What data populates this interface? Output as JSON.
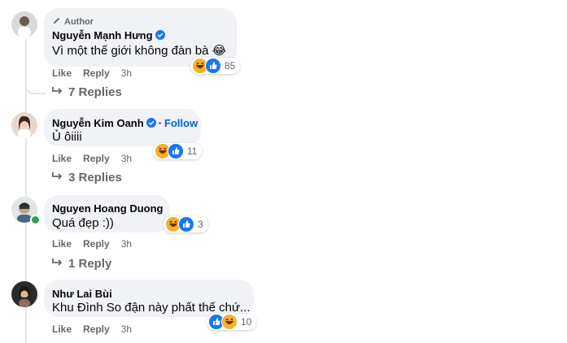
{
  "comments": [
    {
      "author_badge": "Author",
      "name": "Nguyễn Mạnh Hưng",
      "verified": true,
      "text": "Vì một thế giới không đàn bà",
      "emoji": "😂",
      "reaction_count": "85",
      "reactions": [
        "haha",
        "like"
      ],
      "actions": {
        "like": "Like",
        "reply": "Reply",
        "time": "3h"
      },
      "replies": "7 Replies"
    },
    {
      "name": "Nguyễn Kim Oanh",
      "verified": true,
      "follow": "Follow",
      "text": "Ủ ôiiii",
      "reaction_count": "11",
      "reactions": [
        "haha",
        "like"
      ],
      "actions": {
        "like": "Like",
        "reply": "Reply",
        "time": "3h"
      },
      "replies": "3 Replies"
    },
    {
      "name": "Nguyen Hoang Duong",
      "online": true,
      "text": "Quá đẹp :))",
      "reaction_count": "3",
      "reactions": [
        "haha",
        "like"
      ],
      "actions": {
        "like": "Like",
        "reply": "Reply",
        "time": "3h"
      },
      "replies": "1 Reply"
    },
    {
      "name": "Như Lai Bùi",
      "text": "Khu Đình So đận này phất thế chứ...",
      "reaction_count": "10",
      "reactions": [
        "like",
        "haha"
      ],
      "actions": {
        "like": "Like",
        "reply": "Reply",
        "time": "3h"
      }
    }
  ],
  "colors": {
    "bubble": "#f0f2f5",
    "secondary_text": "#65676b",
    "link_blue": "#0064d1",
    "verified_blue": "#1877f2",
    "online_green": "#31a24c"
  }
}
